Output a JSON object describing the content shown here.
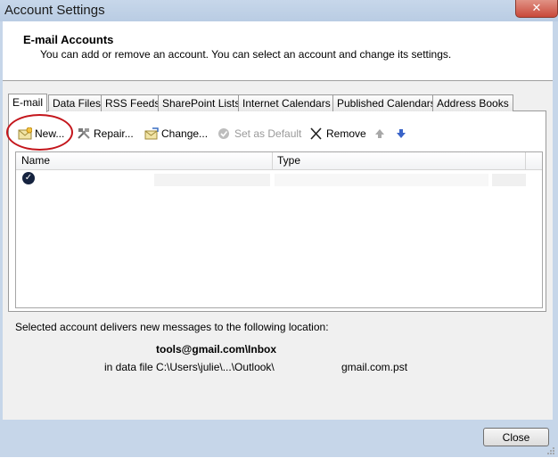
{
  "window": {
    "title": "Account Settings",
    "close_glyph": "✕"
  },
  "header": {
    "title": "E-mail Accounts",
    "subtitle": "You can add or remove an account. You can select an account and change its settings."
  },
  "tabs": [
    {
      "label": "E-mail",
      "active": true
    },
    {
      "label": "Data Files"
    },
    {
      "label": "RSS Feeds"
    },
    {
      "label": "SharePoint Lists"
    },
    {
      "label": "Internet Calendars"
    },
    {
      "label": "Published Calendars"
    },
    {
      "label": "Address Books"
    }
  ],
  "toolbar": {
    "new_label": "New...",
    "repair_label": "Repair...",
    "change_label": "Change...",
    "set_default_label": "Set as Default",
    "remove_label": "Remove"
  },
  "list": {
    "columns": {
      "name": "Name",
      "type": "Type"
    }
  },
  "details": {
    "info_text": "Selected account delivers new messages to the following location:",
    "location_email": "tools@gmail.com\\Inbox",
    "location_file_prefix": "in data file C:\\Users\\julie\\...\\Outlook\\",
    "location_file_suffix": "gmail.com.pst"
  },
  "footer": {
    "close_label": "Close"
  },
  "colors": {
    "annotation_circle": "#c4161c",
    "title_bar": "#c7d7ea"
  }
}
